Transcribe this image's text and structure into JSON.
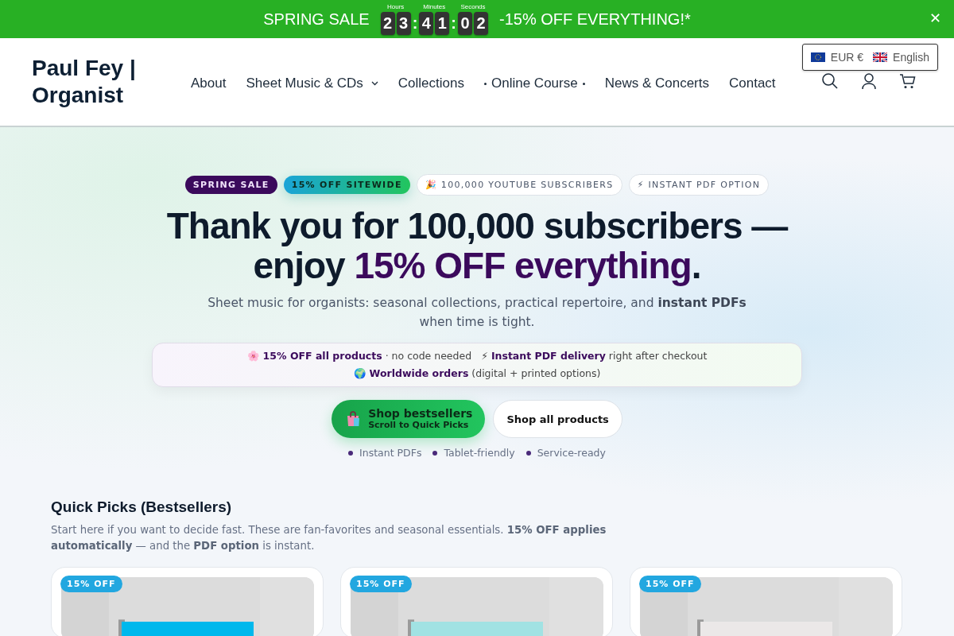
{
  "promo_bar": {
    "sale_label": "SPRING SALE",
    "countdown": [
      {
        "label": "Hours",
        "digits": [
          "2",
          "3"
        ]
      },
      {
        "label": "Minutes",
        "digits": [
          "4",
          "1"
        ]
      },
      {
        "label": "Seconds",
        "digits": [
          "0",
          "2"
        ]
      }
    ],
    "separator": ":",
    "offer": "-15% OFF EVERYTHING!*",
    "close": "✕"
  },
  "header": {
    "logo": "Paul Fey | Organist",
    "nav": [
      {
        "label": "About",
        "kind": "plain"
      },
      {
        "label": "Sheet Music & CDs",
        "kind": "dropdown"
      },
      {
        "label": "Collections",
        "kind": "plain"
      },
      {
        "label": "Online Course",
        "kind": "dotted"
      },
      {
        "label": "News & Concerts",
        "kind": "plain"
      },
      {
        "label": "Contact",
        "kind": "plain"
      }
    ],
    "currency": "EUR €",
    "language": "English"
  },
  "hero": {
    "badges": [
      {
        "text": "SPRING SALE",
        "kind": "dark"
      },
      {
        "text": "15% OFF SITEWIDE",
        "kind": "gradient"
      },
      {
        "text": "🎉 100,000 YOUTUBE SUBSCRIBERS",
        "kind": "outline"
      },
      {
        "text": "⚡ INSTANT PDF OPTION",
        "kind": "outline"
      }
    ],
    "title": "Thank you for 100,000 subscribers — enjoy **15% OFF everything**.",
    "subtitle": "Sheet music for organists: seasonal collections, practical repertoire, and **instant PDFs** when time is tight.",
    "perks": [
      "🌸 **15% OFF all products** · no code needed",
      "⚡ **Instant PDF delivery** right after checkout",
      "🌍 **Worldwide orders** (digital + printed options)"
    ],
    "primary_button": {
      "label": "Shop bestsellers",
      "sublabel": "Scroll to Quick Picks"
    },
    "secondary_button": "Shop all products",
    "features": [
      "Instant PDFs",
      "Tablet-friendly",
      "Service-ready"
    ]
  },
  "quick_picks": {
    "title": "Quick Picks (Bestsellers)",
    "intro": "Start here if you want to decide fast. These are fan-favorites and seasonal essentials. **15% OFF applies automatically** — and the **PDF option** is instant.",
    "cards": [
      {
        "badge": "15% OFF"
      },
      {
        "badge": "15% OFF"
      },
      {
        "badge": "15% OFF"
      }
    ]
  }
}
